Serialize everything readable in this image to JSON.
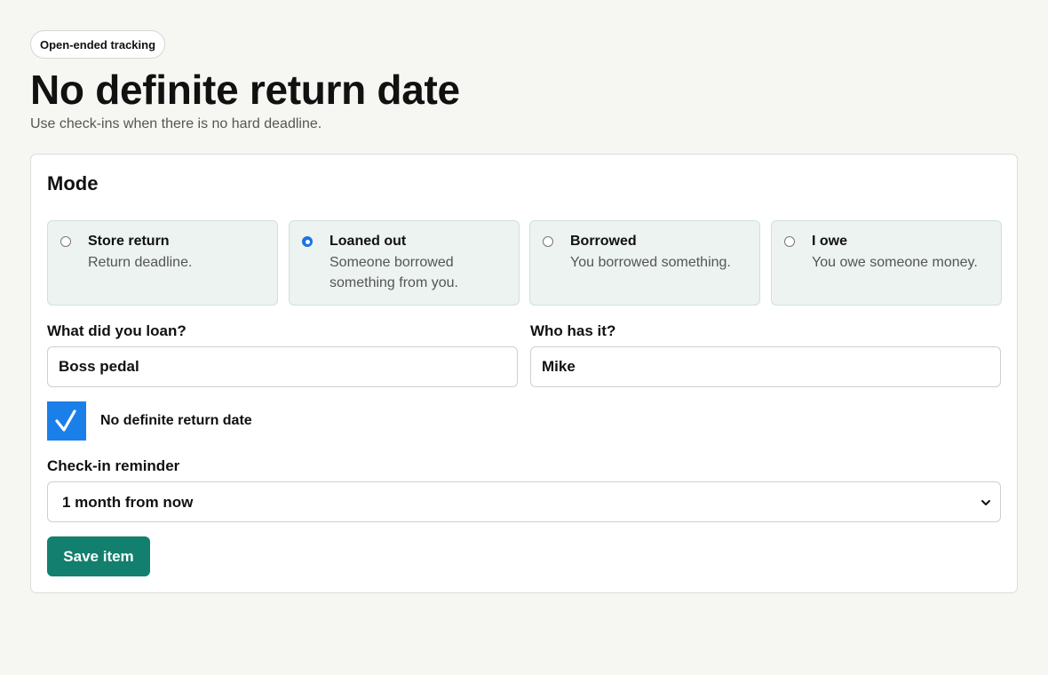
{
  "header": {
    "badge": "Open-ended tracking",
    "title": "No definite return date",
    "subtitle": "Use check-ins when there is no hard deadline."
  },
  "mode": {
    "title": "Mode",
    "options": [
      {
        "label": "Store return",
        "description": "Return deadline.",
        "selected": false
      },
      {
        "label": "Loaned out",
        "description": "Someone borrowed something from you.",
        "selected": true
      },
      {
        "label": "Borrowed",
        "description": "You borrowed something.",
        "selected": false
      },
      {
        "label": "I owe",
        "description": "You owe someone money.",
        "selected": false
      }
    ]
  },
  "form": {
    "item_label": "What did you loan?",
    "item_value": "Boss pedal",
    "person_label": "Who has it?",
    "person_value": "Mike",
    "no_date_label": "No definite return date",
    "no_date_checked": true,
    "reminder_label": "Check-in reminder",
    "reminder_value": "1 month from now",
    "save_label": "Save item"
  },
  "colors": {
    "accent": "#137f6e",
    "checkbox": "#1a7fe8",
    "radio": "#1a73e8",
    "option_bg": "#ecf3f0"
  }
}
